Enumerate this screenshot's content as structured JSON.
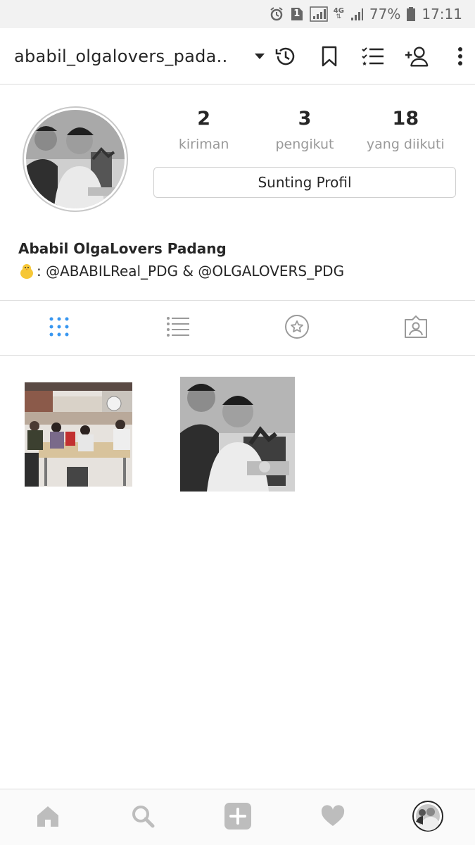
{
  "status_bar": {
    "sim_number": "1",
    "network": "4G",
    "battery": "77%",
    "time": "17:11",
    "icons": [
      "alarm-icon",
      "sim-icon",
      "signal-icon",
      "network-4g-icon",
      "signal-icon",
      "battery-icon"
    ]
  },
  "toolbar": {
    "username": "ababil_olgalovers_pada..",
    "icons": [
      "chevron-down-icon",
      "history-icon",
      "bookmark-icon",
      "list-icon",
      "add-user-icon",
      "more-icon"
    ]
  },
  "profile": {
    "stats": [
      {
        "count": "2",
        "label": "kiriman"
      },
      {
        "count": "3",
        "label": "pengikut"
      },
      {
        "count": "18",
        "label": "yang diikuti"
      }
    ],
    "edit_button": "Sunting Profil",
    "full_name": "Ababil OlgaLovers Padang",
    "bio": ": @ABABILReal_PDG & @OLGALOVERS_PDG"
  },
  "tabs": {
    "items": [
      "grid-icon",
      "list-icon",
      "tagged-star-icon",
      "tagged-person-icon"
    ],
    "active": "grid-icon"
  },
  "posts": [
    "post-photo-group",
    "post-photo-portrait"
  ],
  "bottom_nav": {
    "items": [
      "home-icon",
      "search-icon",
      "add-icon",
      "heart-icon",
      "profile-avatar-icon"
    ]
  },
  "colors": {
    "active_tab": "#3897f0",
    "icon_gray": "#bdbdbd",
    "text": "#262626",
    "muted": "#999999"
  }
}
